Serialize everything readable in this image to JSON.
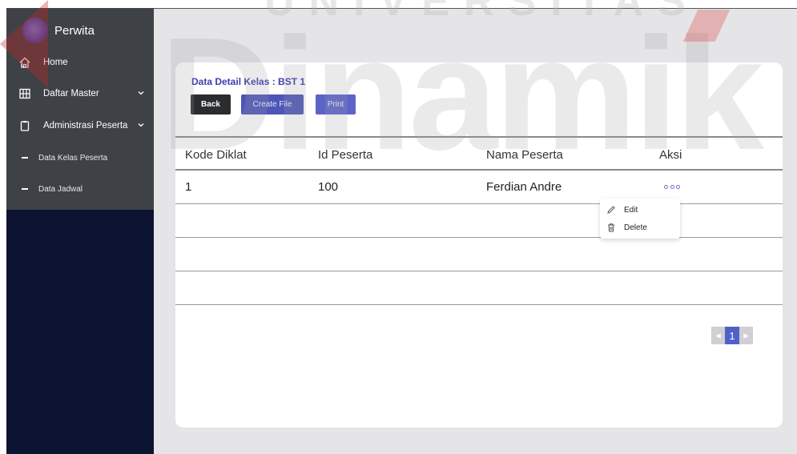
{
  "app": {
    "brand_name": "Perwita"
  },
  "watermark": {
    "top_text": "UNIVERSITAS",
    "big_text": "Dinamik"
  },
  "sidebar": {
    "items": [
      {
        "label": "Home",
        "icon": "home-icon"
      },
      {
        "label": "Daftar Master",
        "icon": "grid-icon",
        "expandable": true
      },
      {
        "label": "Administrasi Peserta",
        "icon": "clipboard-icon",
        "expandable": true
      }
    ],
    "sub_items": [
      {
        "label": "Data Kelas Peserta"
      },
      {
        "label": "Data Jadwal"
      }
    ]
  },
  "main": {
    "title": "Data Detail Kelas : BST 1",
    "buttons": {
      "back": "Back",
      "create_file": "Create File",
      "print": "Print"
    },
    "table": {
      "headers": [
        "Kode Diklat",
        "Id Peserta",
        "Nama Peserta",
        "Aksi"
      ],
      "rows": [
        {
          "kode_diklat": "1",
          "id_peserta": "100",
          "nama_peserta": "Ferdian Andre"
        }
      ]
    },
    "action_menu": {
      "edit": "Edit",
      "delete": "Delete"
    },
    "pagination": {
      "current_page": "1",
      "prev": "◂",
      "next": "▸"
    }
  },
  "colors": {
    "sidebar_upper": "#3e4145",
    "sidebar_lower": "#0d1432",
    "accent": "#4d55b8",
    "title_color": "#3c3db0"
  }
}
